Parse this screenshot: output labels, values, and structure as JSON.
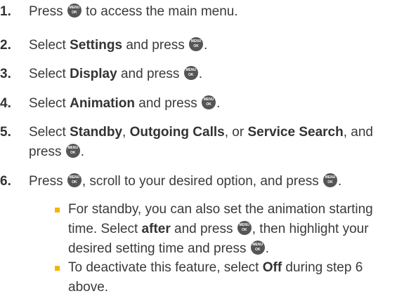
{
  "steps": [
    {
      "num": "1.",
      "a": "Press ",
      "b": " to access the main menu."
    },
    {
      "num": "2.",
      "a": "Select ",
      "bold1": "Settings",
      "b": " and press ",
      "c": "."
    },
    {
      "num": "3.",
      "a": "Select ",
      "bold1": "Display",
      "b": " and press ",
      "c": "."
    },
    {
      "num": "4.",
      "a": "Select ",
      "bold1": "Animation",
      "b": " and press ",
      "c": "."
    },
    {
      "num": "5.",
      "a": "Select ",
      "bold1": "Standby",
      "b": ", ",
      "bold2": "Outgoing Calls",
      "c": ", or ",
      "bold3": "Service Search",
      "d": ", and",
      "line2a": "press ",
      "line2b": "."
    },
    {
      "num": "6.",
      "a": "Press ",
      "b": ", scroll to your desired option, and press ",
      "c": "."
    }
  ],
  "bullets": [
    {
      "line1": "For standby, you can also set the animation starting",
      "line2a": "time. Select ",
      "line2bold": "after",
      "line2b": " and press ",
      "line2c": ", then highlight your",
      "line3a": "desired setting time and press ",
      "line3b": "."
    },
    {
      "line1a": "To deactivate this feature, select ",
      "line1bold": "Off",
      "line1b": " during step 6",
      "line2": "above."
    }
  ],
  "icons": {
    "menu_ok_key": "menu-ok-key-icon"
  },
  "colors": {
    "bullet": "#f5b400",
    "key": "#555555",
    "text": "#3a3a3a"
  }
}
